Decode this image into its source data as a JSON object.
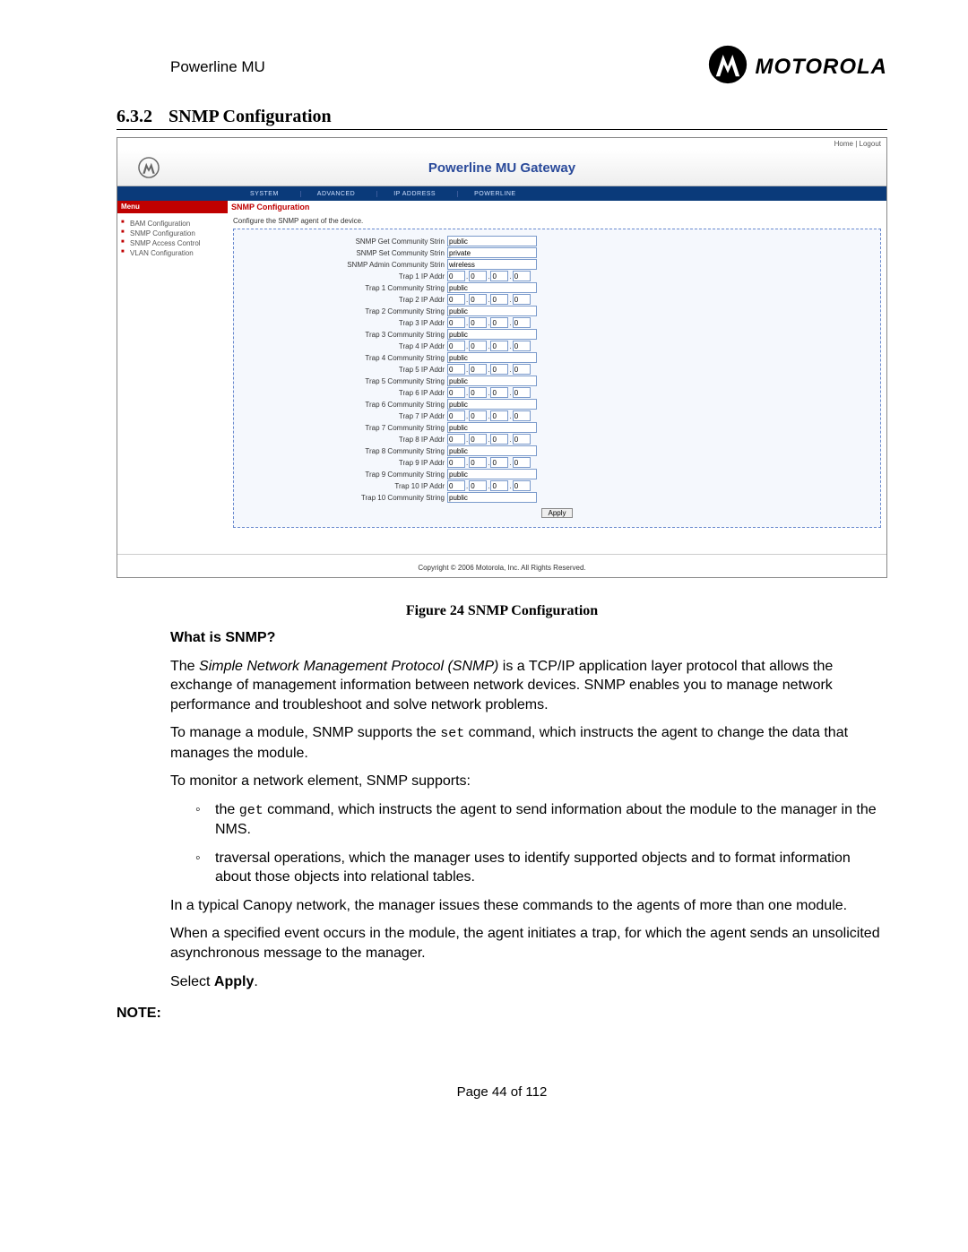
{
  "header": {
    "product": "Powerline MU",
    "brand": "MOTOROLA"
  },
  "section": {
    "number": "6.3.2",
    "title": "SNMP Configuration"
  },
  "screenshot": {
    "top_links": "Home | Logout",
    "title": "Powerline MU Gateway",
    "nav": [
      "SYSTEM",
      "ADVANCED",
      "IP ADDRESS",
      "POWERLINE"
    ],
    "menu_label": "Menu",
    "crumb": "SNMP Configuration",
    "sidebar": [
      "BAM Configuration",
      "SNMP Configuration",
      "SNMP Access Control",
      "VLAN Configuration"
    ],
    "desc": "Configure the SNMP agent of the device.",
    "rows": {
      "get_label": "SNMP Get Community Strin",
      "get_value": "public",
      "set_label": "SNMP Set Community Strin",
      "set_value": "private",
      "admin_label": "SNMP Admin Community Strin",
      "admin_value": "wireless"
    },
    "traps": [
      {
        "ip_label": "Trap 1 IP Addr",
        "cs_label": "Trap 1 Community String",
        "octets": [
          "0",
          "0",
          "0",
          "0"
        ],
        "cs": "public"
      },
      {
        "ip_label": "Trap 2 IP Addr",
        "cs_label": "Trap 2 Community String",
        "octets": [
          "0",
          "0",
          "0",
          "0"
        ],
        "cs": "public"
      },
      {
        "ip_label": "Trap 3 IP Addr",
        "cs_label": "Trap 3 Community String",
        "octets": [
          "0",
          "0",
          "0",
          "0"
        ],
        "cs": "public"
      },
      {
        "ip_label": "Trap 4 IP Addr",
        "cs_label": "Trap 4 Community String",
        "octets": [
          "0",
          "0",
          "0",
          "0"
        ],
        "cs": "public"
      },
      {
        "ip_label": "Trap 5 IP Addr",
        "cs_label": "Trap 5 Community String",
        "octets": [
          "0",
          "0",
          "0",
          "0"
        ],
        "cs": "public"
      },
      {
        "ip_label": "Trap 6 IP Addr",
        "cs_label": "Trap 6 Community String",
        "octets": [
          "0",
          "0",
          "0",
          "0"
        ],
        "cs": "public"
      },
      {
        "ip_label": "Trap 7 IP Addr",
        "cs_label": "Trap 7 Community String",
        "octets": [
          "0",
          "0",
          "0",
          "0"
        ],
        "cs": "public"
      },
      {
        "ip_label": "Trap 8 IP Addr",
        "cs_label": "Trap 8 Community String",
        "octets": [
          "0",
          "0",
          "0",
          "0"
        ],
        "cs": "public"
      },
      {
        "ip_label": "Trap 9 IP Addr",
        "cs_label": "Trap 9 Community String",
        "octets": [
          "0",
          "0",
          "0",
          "0"
        ],
        "cs": "public"
      },
      {
        "ip_label": "Trap 10 IP Addr",
        "cs_label": "Trap 10 Community String",
        "octets": [
          "0",
          "0",
          "0",
          "0"
        ],
        "cs": "public"
      }
    ],
    "apply": "Apply",
    "copyright": "Copyright  ©  2006  Motorola, Inc.  All Rights Reserved."
  },
  "figure_caption": "Figure 24 SNMP Configuration",
  "body": {
    "h_what": "What is SNMP?",
    "p1a": "The ",
    "p1b": "Simple Network Management Protocol (SNMP)",
    "p1c": " is a TCP/IP application layer protocol that allows the exchange of management information between network devices. SNMP enables you to manage network performance and troubleshoot and solve network problems.",
    "p2a": "To manage a module, SNMP supports the ",
    "p2code": "set",
    "p2b": " command, which instructs the agent to change the data that manages the module.",
    "p3": "To monitor a network element, SNMP supports:",
    "li1a": "the ",
    "li1code": "get",
    "li1b": " command, which instructs the agent to send information about the module to the manager in the NMS.",
    "li2": "traversal operations, which the manager uses to identify supported objects and to format information about those objects into relational tables.",
    "p4": "In a typical Canopy network, the manager issues these commands to the agents of more than one module.",
    "p5": "When a specified event occurs in the module, the agent initiates a trap, for which the agent sends an unsolicited asynchronous message to the manager.",
    "p6a": "Select ",
    "p6b": "Apply",
    "p6c": ".",
    "note": "NOTE:"
  },
  "footer": "Page 44 of 112"
}
